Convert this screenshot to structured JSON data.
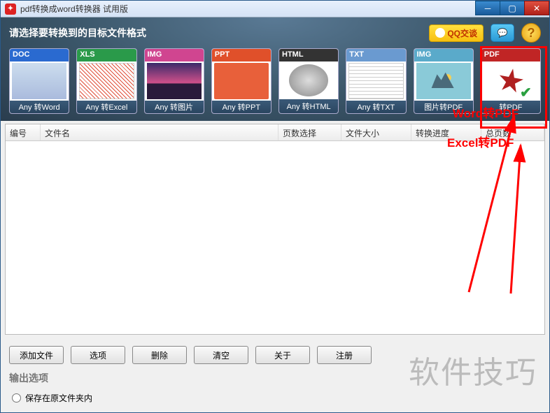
{
  "title": "pdf转换成word转换器 试用版",
  "header": {
    "label": "请选择要转换到的目标文件格式",
    "qq_label": "QQ交谈"
  },
  "formats": [
    {
      "head": "DOC",
      "label": "Any 转Word"
    },
    {
      "head": "XLS",
      "label": "Any 转Excel"
    },
    {
      "head": "IMG",
      "label": "Any 转图片"
    },
    {
      "head": "PPT",
      "label": "Any 转PPT"
    },
    {
      "head": "HTML",
      "label": "Any 转HTML"
    },
    {
      "head": "TXT",
      "label": "Any 转TXT"
    },
    {
      "head": "IMG",
      "label": "图片转PDF"
    },
    {
      "head": "PDF",
      "label": "转PDF"
    }
  ],
  "table": {
    "cols": [
      "编号",
      "文件名",
      "页数选择",
      "文件大小",
      "转换进度",
      "总页数"
    ]
  },
  "buttons": {
    "add_file": "添加文件",
    "options": "选项",
    "delete": "删除",
    "clear": "清空",
    "about": "关于",
    "register": "注册"
  },
  "output": {
    "label": "输出选项",
    "save_original": "保存在原文件夹内"
  },
  "annotations": {
    "word_to_pdf": "Word转PDF",
    "excel_to_pdf": "Excel转PDF"
  },
  "watermark": "软件技巧"
}
